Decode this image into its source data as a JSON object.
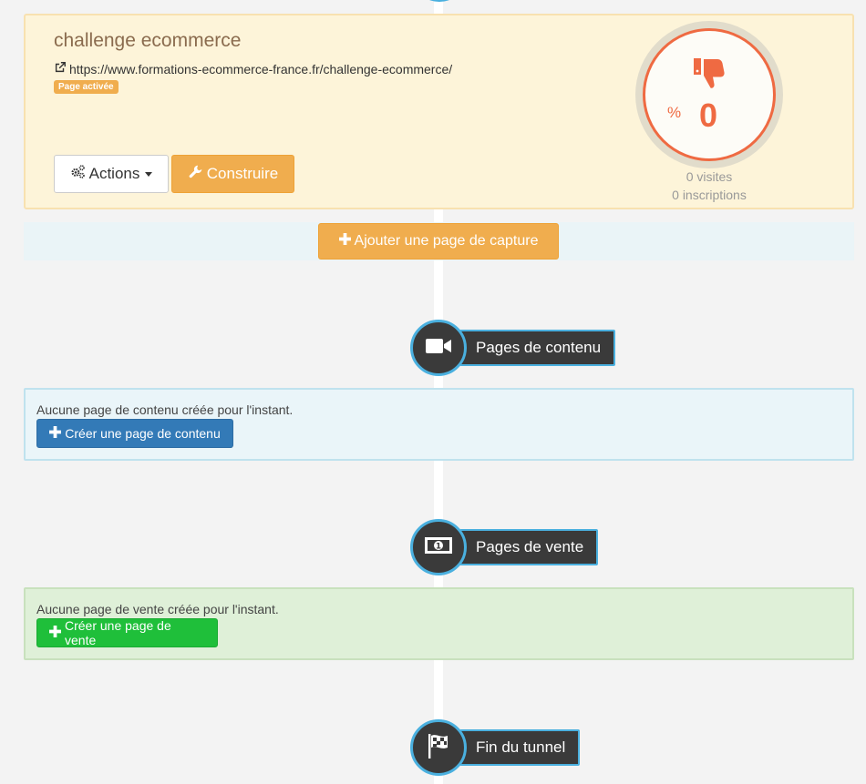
{
  "capture": {
    "title": "challenge ecommerce",
    "url": "https://www.formations-ecommerce-france.fr/challenge-ecommerce/",
    "badge": "Page activée",
    "actions_label": "Actions",
    "build_label": "Construire",
    "gauge": {
      "percent_symbol": "%",
      "value": "0",
      "color": "#ef6a42"
    },
    "visits": "0 visites",
    "signups": "0 inscriptions"
  },
  "add_capture_label": "Ajouter une page de capture",
  "steps": {
    "content": {
      "label": "Pages de contenu",
      "empty_text": "Aucune page de contenu créée pour l'instant.",
      "create_label": "Créer une page de contenu"
    },
    "sales": {
      "label": "Pages de vente",
      "empty_text": "Aucune page de vente créée pour l'instant.",
      "create_label": "Créer une page de vente"
    },
    "end": {
      "label": "Fin du tunnel"
    }
  },
  "icons": {
    "external_link": "external-link-icon",
    "gears": "gears-icon",
    "wrench": "wrench-icon",
    "thumbs_down": "thumbs-down-icon",
    "plus": "plus-icon",
    "video": "video-camera-icon",
    "money": "banknote-icon",
    "flag": "checkered-flag-icon"
  },
  "colors": {
    "warning": "#f0ad4e",
    "primary": "#337ab7",
    "success": "#1fbf3a",
    "node_border": "#4ab0df"
  }
}
